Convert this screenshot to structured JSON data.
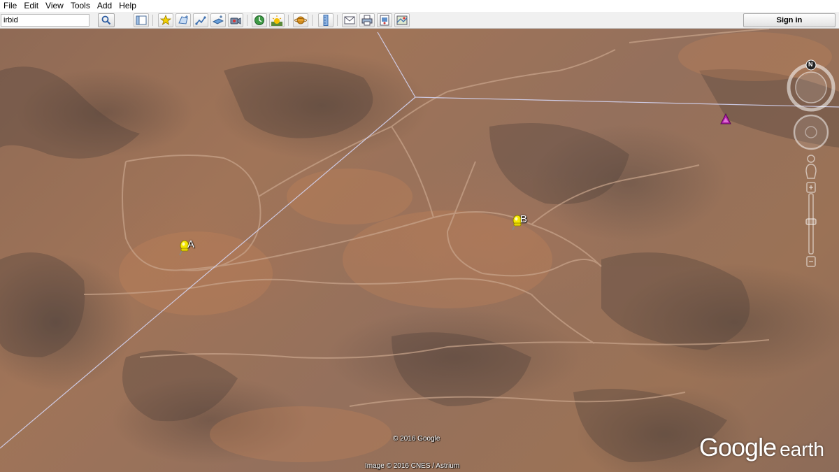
{
  "menu": [
    "File",
    "Edit",
    "View",
    "Tools",
    "Add",
    "Help"
  ],
  "search": {
    "value": "irbid"
  },
  "toolbar": {
    "buttons": [
      "sidebar-toggle-icon",
      "placemark-icon",
      "polygon-icon",
      "path-icon",
      "image-overlay-icon",
      "record-tour-icon",
      "historical-imagery-icon",
      "sun-icon",
      "planets-icon",
      "ruler-icon",
      "email-icon",
      "print-icon",
      "save-image-icon",
      "view-in-maps-icon"
    ],
    "signin_label": "Sign in"
  },
  "map": {
    "placemarks": [
      {
        "label": "A"
      },
      {
        "label": "B"
      }
    ],
    "copyright": "© 2016 Google",
    "imagery_credit": "Image © 2016 CNES / Astrium",
    "logo_google": "Google",
    "logo_earth": "earth",
    "compass_north": "N"
  },
  "colors": {
    "placemark_yellow": "#f5e800",
    "triangle_magenta": "#b01fa8",
    "path_line": "#c8c8f0"
  }
}
